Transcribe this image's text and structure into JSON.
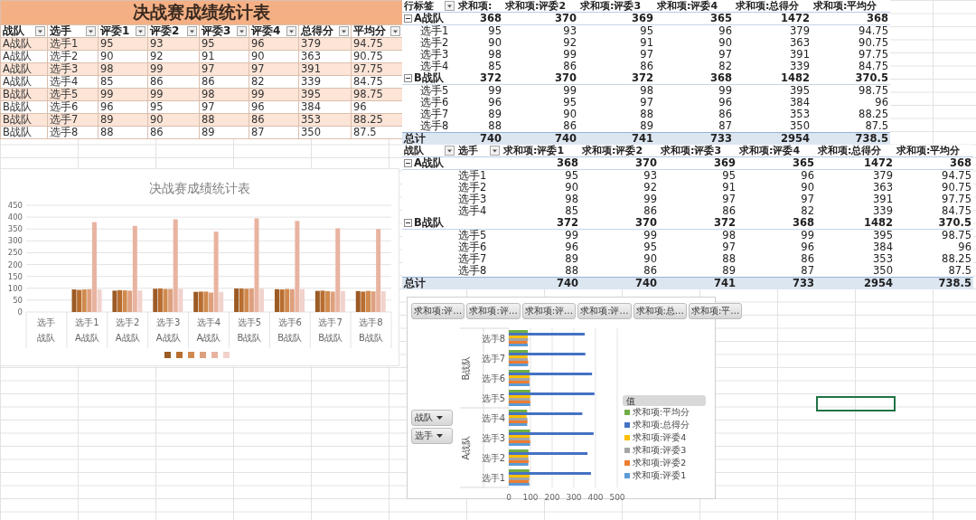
{
  "source_table": {
    "title": "决战赛成绩统计表",
    "columns": [
      "战队",
      "选手",
      "评委1",
      "评委2",
      "评委3",
      "评委4",
      "总得分",
      "平均分"
    ],
    "rows": [
      [
        "A战队",
        "选手1",
        "95",
        "93",
        "95",
        "96",
        "379",
        "94.75"
      ],
      [
        "A战队",
        "选手2",
        "90",
        "92",
        "91",
        "90",
        "363",
        "90.75"
      ],
      [
        "A战队",
        "选手3",
        "98",
        "99",
        "97",
        "97",
        "391",
        "97.75"
      ],
      [
        "A战队",
        "选手4",
        "85",
        "86",
        "86",
        "82",
        "339",
        "84.75"
      ],
      [
        "B战队",
        "选手5",
        "99",
        "99",
        "98",
        "99",
        "395",
        "98.75"
      ],
      [
        "B战队",
        "选手6",
        "96",
        "95",
        "97",
        "96",
        "384",
        "96"
      ],
      [
        "B战队",
        "选手7",
        "89",
        "90",
        "88",
        "86",
        "353",
        "88.25"
      ],
      [
        "B战队",
        "选手8",
        "88",
        "86",
        "89",
        "87",
        "350",
        "87.5"
      ]
    ]
  },
  "column_chart": {
    "category_groups": [
      "战队",
      "A战队",
      "A战队",
      "A战队",
      "A战队",
      "B战队",
      "B战队",
      "B战队",
      "B战队"
    ],
    "chart_data": {
      "type": "bar",
      "title": "决战赛成绩统计表",
      "categories": [
        "选手",
        "选手1",
        "选手2",
        "选手3",
        "选手4",
        "选手5",
        "选手6",
        "选手7",
        "选手8"
      ],
      "grid": true,
      "series": [
        {
          "color": "#9c5a24",
          "values": [
            null,
            95,
            90,
            98,
            85,
            99,
            96,
            89,
            88
          ]
        },
        {
          "color": "#b86d30",
          "values": [
            null,
            93,
            92,
            99,
            86,
            99,
            95,
            90,
            86
          ]
        },
        {
          "color": "#d08a4e",
          "values": [
            null,
            95,
            91,
            97,
            86,
            98,
            97,
            88,
            89
          ]
        },
        {
          "color": "#dda07e",
          "values": [
            null,
            96,
            90,
            97,
            82,
            99,
            96,
            86,
            87
          ]
        },
        {
          "color": "#e8b3a0",
          "values": [
            null,
            379,
            363,
            391,
            339,
            395,
            384,
            353,
            350
          ]
        },
        {
          "color": "#f1d2cc",
          "values": [
            null,
            94.75,
            90.75,
            97.75,
            84.75,
            98.75,
            96,
            88.25,
            87.5
          ]
        }
      ],
      "ylim": [
        0,
        450
      ],
      "yticks": [
        0,
        50,
        100,
        150,
        200,
        250,
        300,
        350,
        400,
        450
      ]
    }
  },
  "pivot_table_1": {
    "row_headers": [
      "行标签"
    ],
    "columns": [
      "求和项:",
      "求和项:评委2",
      "求和项:评委3",
      "求和项:评委4",
      "求和项:总得分",
      "求和项:平均分"
    ],
    "groups": [
      {
        "label": "A战队",
        "expanded": true,
        "values": [
          "368",
          "370",
          "369",
          "365",
          "1472",
          "368"
        ],
        "rows": [
          {
            "label": "选手1",
            "values": [
              "95",
              "93",
              "95",
              "96",
              "379",
              "94.75"
            ]
          },
          {
            "label": "选手2",
            "values": [
              "90",
              "92",
              "91",
              "90",
              "363",
              "90.75"
            ]
          },
          {
            "label": "选手3",
            "values": [
              "98",
              "99",
              "97",
              "97",
              "391",
              "97.75"
            ]
          },
          {
            "label": "选手4",
            "values": [
              "85",
              "86",
              "86",
              "82",
              "339",
              "84.75"
            ]
          }
        ]
      },
      {
        "label": "B战队",
        "expanded": true,
        "values": [
          "372",
          "370",
          "372",
          "368",
          "1482",
          "370.5"
        ],
        "rows": [
          {
            "label": "选手5",
            "values": [
              "99",
              "99",
              "98",
              "99",
              "395",
              "98.75"
            ]
          },
          {
            "label": "选手6",
            "values": [
              "96",
              "95",
              "97",
              "96",
              "384",
              "96"
            ]
          },
          {
            "label": "选手7",
            "values": [
              "89",
              "90",
              "88",
              "86",
              "353",
              "88.25"
            ]
          },
          {
            "label": "选手8",
            "values": [
              "88",
              "86",
              "89",
              "87",
              "350",
              "87.5"
            ]
          }
        ]
      }
    ],
    "grand_total": {
      "label": "总计",
      "values": [
        "740",
        "740",
        "741",
        "733",
        "2954",
        "738.5"
      ]
    }
  },
  "pivot_table_2": {
    "row_headers": [
      "战队",
      "选手"
    ],
    "columns": [
      "求和项:评委1",
      "求和项:评委2",
      "求和项:评委3",
      "求和项:评委4",
      "求和项:总得分",
      "求和项:平均分"
    ],
    "groups": [
      {
        "label": "A战队",
        "expanded": true,
        "values": [
          "368",
          "370",
          "369",
          "365",
          "1472",
          "368"
        ],
        "rows": [
          {
            "label": "选手1",
            "values": [
              "95",
              "93",
              "95",
              "96",
              "379",
              "94.75"
            ]
          },
          {
            "label": "选手2",
            "values": [
              "90",
              "92",
              "91",
              "90",
              "363",
              "90.75"
            ]
          },
          {
            "label": "选手3",
            "values": [
              "98",
              "99",
              "97",
              "97",
              "391",
              "97.75"
            ]
          },
          {
            "label": "选手4",
            "values": [
              "85",
              "86",
              "86",
              "82",
              "339",
              "84.75"
            ]
          }
        ]
      },
      {
        "label": "B战队",
        "expanded": true,
        "values": [
          "372",
          "370",
          "372",
          "368",
          "1482",
          "370.5"
        ],
        "rows": [
          {
            "label": "选手5",
            "values": [
              "99",
              "99",
              "98",
              "99",
              "395",
              "98.75"
            ]
          },
          {
            "label": "选手6",
            "values": [
              "96",
              "95",
              "97",
              "96",
              "384",
              "96"
            ]
          },
          {
            "label": "选手7",
            "values": [
              "89",
              "90",
              "88",
              "86",
              "353",
              "88.25"
            ]
          },
          {
            "label": "选手8",
            "values": [
              "88",
              "86",
              "89",
              "87",
              "350",
              "87.5"
            ]
          }
        ]
      }
    ],
    "grand_total": {
      "label": "总计",
      "values": [
        "740",
        "740",
        "741",
        "733",
        "2954",
        "738.5"
      ]
    }
  },
  "pivot_chart": {
    "field_buttons": [
      "求和项:评…",
      "求和项:评…",
      "求和项:评…",
      "求和项:评…",
      "求和项:总…",
      "求和项:平…"
    ],
    "axis_buttons": [
      "战队",
      "选手"
    ],
    "axis_groups": [
      "B战队",
      "A战队"
    ],
    "legend_title": "值",
    "chart_data": {
      "type": "bar",
      "orientation": "horizontal",
      "categories": [
        "选手8",
        "选手7",
        "选手6",
        "选手5",
        "选手4",
        "选手3",
        "选手2",
        "选手1"
      ],
      "grid": true,
      "legend": true,
      "series": [
        {
          "name": "求和项:评委1",
          "color": "#5b9bd5",
          "values": [
            88,
            89,
            96,
            99,
            85,
            98,
            90,
            95
          ]
        },
        {
          "name": "求和项:评委2",
          "color": "#ed7d31",
          "values": [
            86,
            90,
            95,
            99,
            86,
            99,
            92,
            93
          ]
        },
        {
          "name": "求和项:评委3",
          "color": "#a5a5a5",
          "values": [
            89,
            88,
            97,
            98,
            86,
            97,
            91,
            95
          ]
        },
        {
          "name": "求和项:评委4",
          "color": "#ffc000",
          "values": [
            87,
            86,
            96,
            99,
            82,
            97,
            90,
            96
          ]
        },
        {
          "name": "求和项:总得分",
          "color": "#4472c4",
          "values": [
            350,
            353,
            384,
            395,
            339,
            391,
            363,
            379
          ]
        },
        {
          "name": "求和项:平均分",
          "color": "#70ad47",
          "values": [
            87.5,
            88.25,
            96,
            98.75,
            84.75,
            97.75,
            90.75,
            94.75
          ]
        }
      ],
      "xlim": [
        0,
        500
      ],
      "xticks": [
        0,
        100,
        200,
        300,
        400,
        500
      ]
    }
  }
}
